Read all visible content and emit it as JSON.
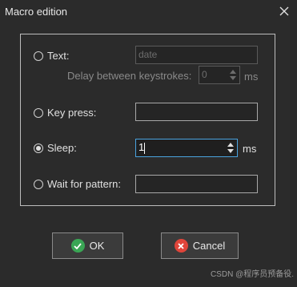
{
  "window": {
    "title": "Macro edition"
  },
  "options": {
    "text": {
      "label": "Text:",
      "value": "date",
      "selected": false
    },
    "delay": {
      "label": "Delay between keystrokes:",
      "value": "0",
      "unit": "ms"
    },
    "key_press": {
      "label": "Key press:",
      "value": "",
      "selected": false
    },
    "sleep": {
      "label": "Sleep:",
      "value": "1",
      "unit": "ms",
      "selected": true
    },
    "wait": {
      "label": "Wait for pattern:",
      "value": "",
      "selected": false
    }
  },
  "buttons": {
    "ok": "OK",
    "cancel": "Cancel"
  },
  "watermark": "CSDN @程序员预备役.",
  "colors": {
    "ok_icon": "#3aa655",
    "cancel_icon": "#e0453a",
    "focus": "#4aa3df"
  }
}
